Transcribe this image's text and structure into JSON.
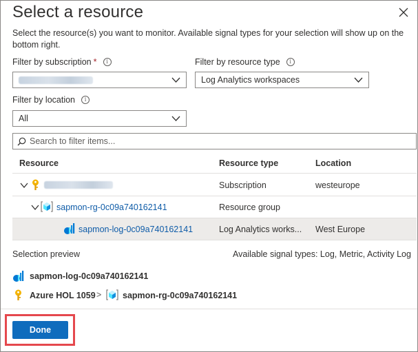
{
  "header": {
    "title": "Select a resource",
    "description": "Select the resource(s) you want to monitor. Available signal types for your selection will show up on the bottom right."
  },
  "filters": {
    "subscription_label": "Filter by subscription",
    "subscription_required": "*",
    "resource_type_label": "Filter by resource type",
    "resource_type_value": "Log Analytics workspaces",
    "location_label": "Filter by location",
    "location_value": "All"
  },
  "search": {
    "placeholder": "Search to filter items..."
  },
  "table": {
    "headers": [
      "Resource",
      "Resource type",
      "Location"
    ],
    "rows": [
      {
        "name": "",
        "type": "Subscription",
        "location": "westeurope"
      },
      {
        "name": "sapmon-rg-0c09a740162141",
        "type": "Resource group",
        "location": ""
      },
      {
        "name": "sapmon-log-0c09a740162141",
        "type": "Log Analytics works...",
        "location": "West Europe"
      }
    ]
  },
  "preview": {
    "label": "Selection preview",
    "signal_types": "Available signal types: Log, Metric, Activity Log",
    "selected_resource": "sapmon-log-0c09a740162141",
    "path_subscription": "Azure HOL 1059",
    "path_separator": ">",
    "path_resource_group": "sapmon-rg-0c09a740162141"
  },
  "footer": {
    "done_label": "Done"
  },
  "colors": {
    "accent": "#0f6cbd",
    "link": "#0f5ca8",
    "highlight": "#e5484d",
    "selected_row": "#edebe9"
  }
}
